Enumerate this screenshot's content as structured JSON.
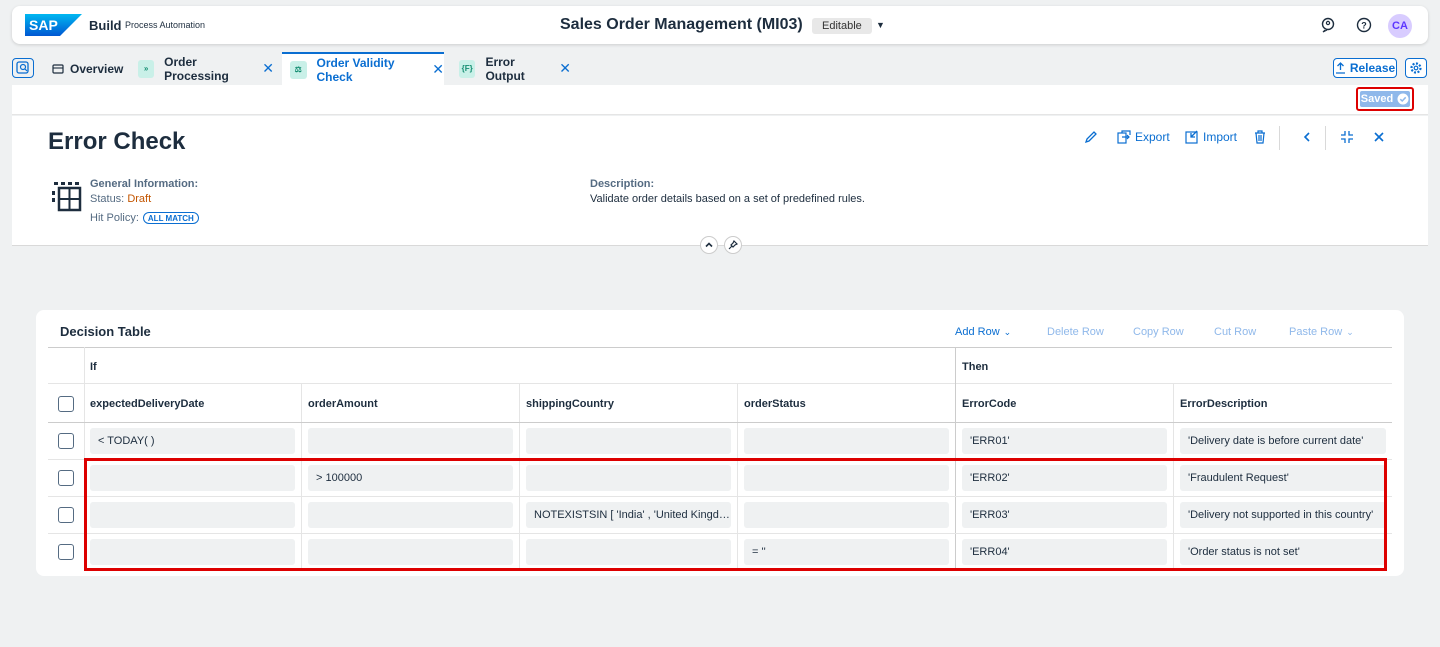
{
  "shell": {
    "logo_text": "SAP",
    "brand": "Build",
    "brand_sub": "Process Automation",
    "app_title": "Sales Order Management (MI03)",
    "badge": "Editable",
    "avatar": "CA",
    "icons": [
      "feedback-icon",
      "help-icon"
    ]
  },
  "tabs": [
    {
      "label": "Overview",
      "icon": "overview-icon",
      "closable": false
    },
    {
      "label": "Order Processing",
      "icon": "process-icon",
      "closable": true
    },
    {
      "label": "Order Validity Check",
      "icon": "decision-icon",
      "closable": true,
      "active": true
    },
    {
      "label": "Error Output",
      "icon": "data-type-icon",
      "closable": true
    }
  ],
  "tab_actions": {
    "release": "Release"
  },
  "saved": {
    "label": "Saved"
  },
  "header": {
    "title": "Error Check",
    "actions": {
      "export": "Export",
      "import": "Import"
    },
    "general_label": "General Information:",
    "status_label": "Status:",
    "status_value": "Draft",
    "hit_policy_label": "Hit Policy:",
    "hit_policy_value": "ALL MATCH",
    "description_label": "Description:",
    "description_text": "Validate order details based on a set of predefined rules."
  },
  "table": {
    "title": "Decision Table",
    "toolbar": {
      "add_row": "Add Row",
      "delete_row": "Delete Row",
      "copy_row": "Copy Row",
      "cut_row": "Cut Row",
      "paste_row": "Paste Row"
    },
    "if_label": "If",
    "then_label": "Then",
    "columns": [
      "expectedDeliveryDate",
      "orderAmount",
      "shippingCountry",
      "orderStatus",
      "ErrorCode",
      "ErrorDescription"
    ],
    "rows": [
      [
        "< TODAY( )",
        "",
        "",
        "",
        "'ERR01'",
        "'Delivery date is before current date'"
      ],
      [
        "",
        "> 100000",
        "",
        "",
        "'ERR02'",
        "'Fraudulent Request'"
      ],
      [
        "",
        "",
        "NOTEXISTSIN [ 'India' , 'United Kingdo...",
        "",
        "'ERR03'",
        "'Delivery not supported in this country'"
      ],
      [
        "",
        "",
        "",
        "= ''",
        "'ERR04'",
        "'Order status is not set'"
      ]
    ]
  }
}
